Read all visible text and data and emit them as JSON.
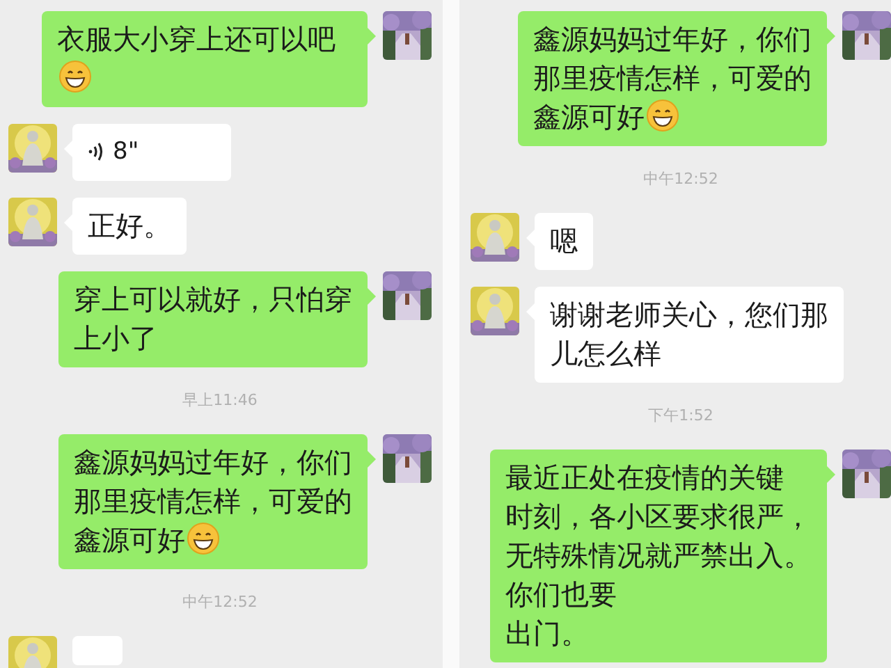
{
  "panels": [
    {
      "items": [
        {
          "kind": "outgoing",
          "lines": [
            "衣服大小穿上还可以吧"
          ],
          "emoji": true
        },
        {
          "kind": "voice",
          "duration": "8\""
        },
        {
          "kind": "incoming",
          "lines": [
            "正好。"
          ]
        },
        {
          "kind": "outgoing",
          "lines": [
            "穿上可以就好，只怕穿",
            "上小了"
          ]
        },
        {
          "kind": "time",
          "text": "早上11:46"
        },
        {
          "kind": "outgoing",
          "lines": [
            "鑫源妈妈过年好，你们",
            "那里疫情怎样，可爱的",
            "鑫源可好"
          ],
          "emoji": true
        },
        {
          "kind": "time",
          "text": "中午12:52"
        },
        {
          "kind": "incoming"
        }
      ]
    },
    {
      "items": [
        {
          "kind": "outgoing",
          "lines": [
            "鑫源妈妈过年好，你们",
            "那里疫情怎样，可爱的",
            "鑫源可好"
          ],
          "emoji": true
        },
        {
          "kind": "time",
          "text": "中午12:52"
        },
        {
          "kind": "incoming",
          "lines": [
            "嗯"
          ]
        },
        {
          "kind": "incoming",
          "lines": [
            "谢谢老师关心，您们那",
            "儿怎么样"
          ]
        },
        {
          "kind": "time",
          "text": "下午1:52"
        },
        {
          "kind": "outgoing",
          "lines": [
            "最近正处在疫情的关键",
            "时刻，各小区要求很严，",
            "无特殊情况就严禁出入。",
            "你们也要",
            "出门。"
          ]
        }
      ]
    }
  ]
}
